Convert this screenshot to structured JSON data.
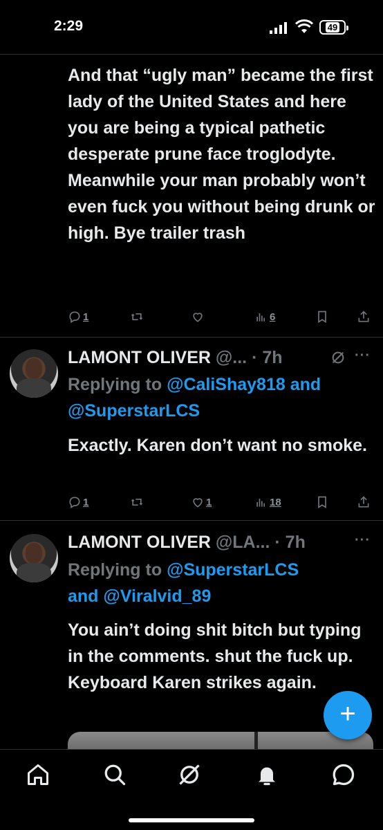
{
  "status_bar": {
    "time": "2:29",
    "battery": "49"
  },
  "tweets": [
    {
      "text": "And that “ugly man” became the first lady of the United States and here you are being a typical pathetic desperate prune face troglodyte. Meanwhile your man probably won’t even fuck you without being drunk or high. Bye trailer trash",
      "replies": "1",
      "retweets": "",
      "likes": "",
      "views": "6"
    },
    {
      "name": "LAMONT OLIVER",
      "handle": "@...",
      "time": "· 7h",
      "replying_prefix": "Replying to ",
      "mention_1": "@CaliShay818",
      "joiner": " and",
      "mention_2": "@SuperstarLCS",
      "text": "Exactly. Karen don’t want no smoke.",
      "replies": "1",
      "retweets": "",
      "likes": "1",
      "views": "18"
    },
    {
      "name": "LAMONT OLIVER",
      "handle": "@LA...",
      "time": "· 7h",
      "replying_prefix": "Replying to ",
      "mention_1": "@SuperstarLCS",
      "joiner": "and ",
      "mention_2": "@Viralvid_89",
      "text": "You ain’t doing shit bitch but typing in the comments. shut the fuck up. Keyboard Karen strikes again."
    }
  ],
  "more_label": "···",
  "fab_label": "+",
  "nav": [
    "home-icon",
    "search-icon",
    "grok-icon",
    "notifications-icon",
    "messages-icon"
  ]
}
